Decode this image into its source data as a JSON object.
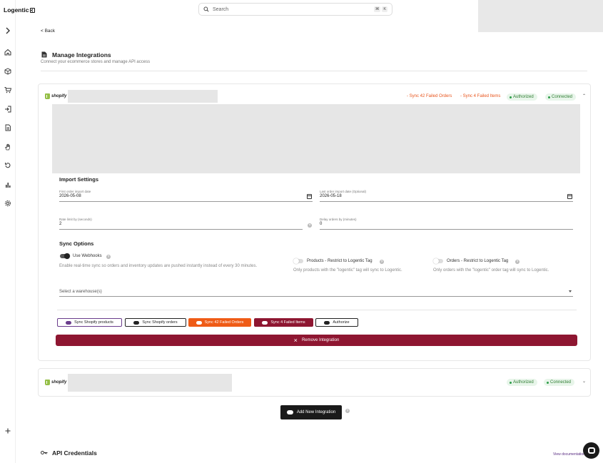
{
  "app": {
    "name": "Logentic"
  },
  "search": {
    "placeholder": "Search",
    "shortcut_mod": "⌘",
    "shortcut_key": "K"
  },
  "nav": {
    "back_label": "< Back",
    "icons": [
      "chevron-right-icon",
      "home-icon",
      "box-icon",
      "cart-icon",
      "login-icon",
      "document-icon",
      "hand-icon",
      "refresh-icon",
      "bar-chart-icon",
      "gear-icon",
      "plus-icon"
    ]
  },
  "page": {
    "title": "Manage Integrations",
    "subtitle": "Connect your ecommerce stores and manage API access"
  },
  "integration1": {
    "platform": "shopify",
    "sync_failed_orders_link": "- Sync 42 Failed Orders",
    "sync_failed_items_link": "- Sync 4 Failed Items",
    "status_authorized": "Authorized",
    "status_connected": "Connected",
    "import_settings": {
      "title": "Import Settings",
      "first_order_label": "First order import date",
      "first_order_value": "2026-05-08",
      "last_order_label": "Last order import date (Optional)",
      "last_order_value": "2026-05-18",
      "rate_limit_label": "Rate limit by (seconds)",
      "rate_limit_value": "2",
      "delay_label": "Delay orders by (minutes)",
      "delay_value": "0"
    },
    "sync_options": {
      "title": "Sync Options",
      "webhooks_label": "Use Webhooks",
      "webhooks_on": true,
      "webhooks_desc": "Enable real-time sync so orders and inventory updates are pushed instantly instead of every 30 minutes.",
      "products_label": "Products - Restrict to Logentic Tag",
      "products_on": false,
      "products_desc": "Only products with the \"logentic\" tag will sync to Logentic.",
      "orders_label": "Orders - Restrict to Logentic Tag",
      "orders_on": false,
      "orders_desc": "Only orders with the \"logentic\" order tag will sync to Logentic."
    },
    "warehouse_placeholder": "Select a warehouse(s)",
    "buttons": {
      "sync_products": "Sync Shopify products",
      "sync_orders": "Sync Shopify orders",
      "sync_failed_orders": "Sync 42 Failed Orders",
      "sync_failed_items": "Sync 4 Failed Items",
      "authorize": "Authorize",
      "remove": "Remove Integration"
    }
  },
  "integration2": {
    "platform": "shopify",
    "status_authorized": "Authorized",
    "status_connected": "Connected"
  },
  "add_integration_label": "Add New Integration",
  "api": {
    "title": "API Credentials",
    "docs_link": "View documentation"
  },
  "colors": {
    "accent_orange": "#ef5b16",
    "accent_maroon": "#8e1631",
    "status_green": "#2e7d32",
    "brand_purple": "#5a2d82"
  }
}
